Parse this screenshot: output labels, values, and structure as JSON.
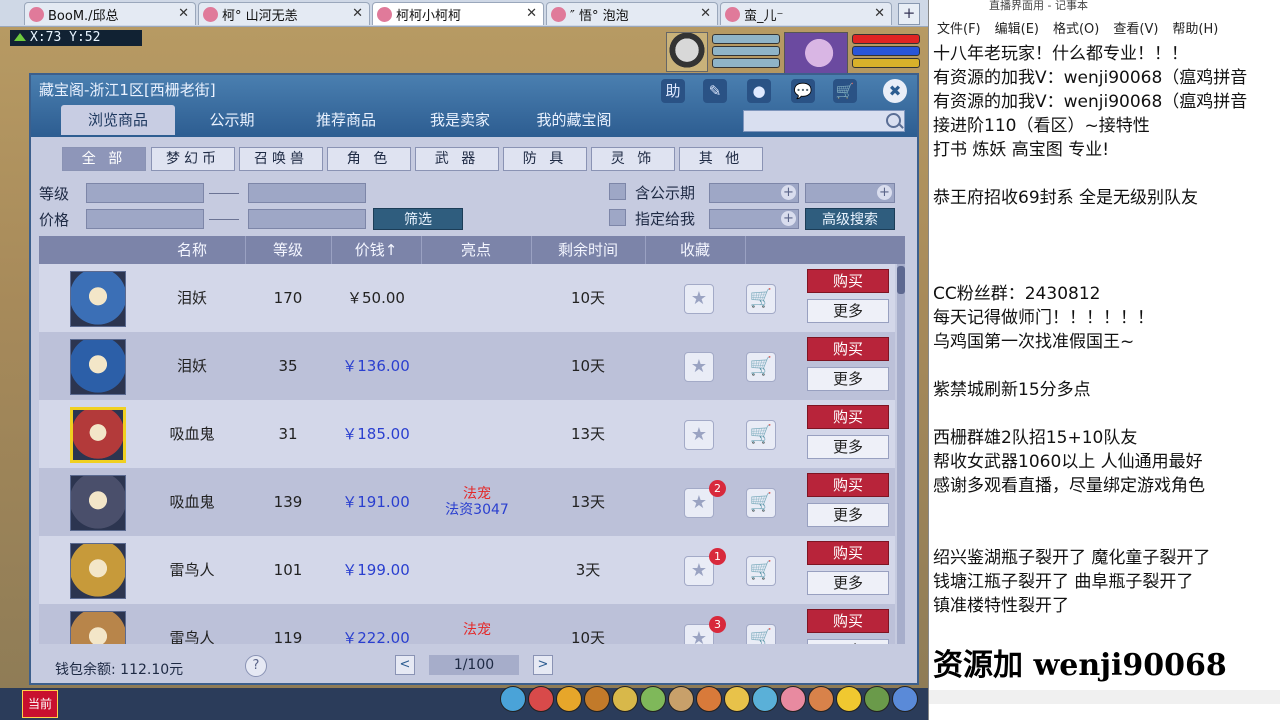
{
  "browser_tabs": [
    {
      "label": "BooM./邱总",
      "active": false
    },
    {
      "label": "柯° 山河无恙",
      "active": false
    },
    {
      "label": "柯柯小柯柯",
      "active": true
    },
    {
      "label": "″ 悟° 泡泡",
      "active": false
    },
    {
      "label": "蛮_儿⁻",
      "active": false
    }
  ],
  "game": {
    "coords": "X:73 Y:52",
    "hotbar_label": "当前"
  },
  "window": {
    "title": "藏宝阁-浙江1区[西栅老街]",
    "header_buttons": [
      "助",
      "✎",
      "●",
      "💬",
      "🛒",
      "✖"
    ],
    "tabs": [
      "浏览商品",
      "公示期",
      "推荐商品",
      "我是卖家",
      "我的藏宝阁"
    ],
    "active_tab": 0,
    "search_placeholder": ""
  },
  "categories": [
    "全 部",
    "梦幻币",
    "召唤兽",
    "角 色",
    "武 器",
    "防 具",
    "灵 饰",
    "其 他"
  ],
  "filters": {
    "level_label": "等级",
    "price_label": "价格",
    "filter_button": "筛选",
    "public_label": "含公示期",
    "assigned_label": "指定给我",
    "advanced_button": "高级搜索"
  },
  "table": {
    "headers": [
      "名称",
      "等级",
      "价钱↑",
      "亮点",
      "剩余时间",
      "收藏"
    ],
    "buy_label": "购买",
    "more_label": "更多",
    "rows": [
      {
        "name": "泪妖",
        "level": "170",
        "price": "￥50.00",
        "price_color": "#222222",
        "highlight1": "",
        "highlight2": "",
        "time": "10天",
        "badge": "",
        "pic_color": "#3b6fb6"
      },
      {
        "name": "泪妖",
        "level": "35",
        "price": "￥136.00",
        "price_color": "#2a3fcf",
        "highlight1": "",
        "highlight2": "",
        "time": "10天",
        "badge": "",
        "pic_color": "#2c5fa8"
      },
      {
        "name": "吸血鬼",
        "level": "31",
        "price": "￥185.00",
        "price_color": "#2a3fcf",
        "highlight1": "",
        "highlight2": "",
        "time": "13天",
        "badge": "",
        "pic_color": "#b33a3a"
      },
      {
        "name": "吸血鬼",
        "level": "139",
        "price": "￥191.00",
        "price_color": "#2a3fcf",
        "highlight1": "法宠",
        "highlight2": "法资3047",
        "time": "13天",
        "badge": "2",
        "pic_color": "#4a4f6b"
      },
      {
        "name": "雷鸟人",
        "level": "101",
        "price": "￥199.00",
        "price_color": "#2a3fcf",
        "highlight1": "",
        "highlight2": "",
        "time": "3天",
        "badge": "1",
        "pic_color": "#c79a3a"
      },
      {
        "name": "雷鸟人",
        "level": "119",
        "price": "￥222.00",
        "price_color": "#2a3fcf",
        "highlight1": "法宠",
        "highlight2": "",
        "time": "10天",
        "badge": "3",
        "pic_color": "#b8854a"
      }
    ]
  },
  "footer": {
    "wallet": "钱包余额: 112.10元",
    "help": "?",
    "prev": "<",
    "next": ">",
    "page": "1/100"
  },
  "notepad": {
    "title": "直播界面用 - 记事本",
    "menu": [
      "文件(F)",
      "编辑(E)",
      "格式(O)",
      "查看(V)",
      "帮助(H)"
    ],
    "lines": [
      "十八年老玩家！什么都专业！！！",
      "有资源的加我V：wenji90068（瘟鸡拼音",
      "有资源的加我V：wenji90068（瘟鸡拼音",
      "接进阶110（看区）~接特性",
      "打书 炼妖 高宝图 专业!",
      "",
      "恭王府招收69封系 全是无级别队友",
      "",
      "",
      "",
      "CC粉丝群：2430812",
      "每天记得做师门！！！！！！",
      "乌鸡国第一次找准假国王~",
      "",
      "紫禁城刷新15分多点",
      "",
      "西栅群雄2队招15+10队友",
      "帮收女武器1060以上 人仙通用最好",
      "感谢多观看直播，尽量绑定游戏角色",
      "",
      "",
      "绍兴鉴湖瓶子裂开了 魔化童子裂开了",
      "钱塘江瓶子裂开了 曲阜瓶子裂开了",
      "镇准楼特性裂开了"
    ],
    "big_text": "资源加 wenji90068"
  }
}
